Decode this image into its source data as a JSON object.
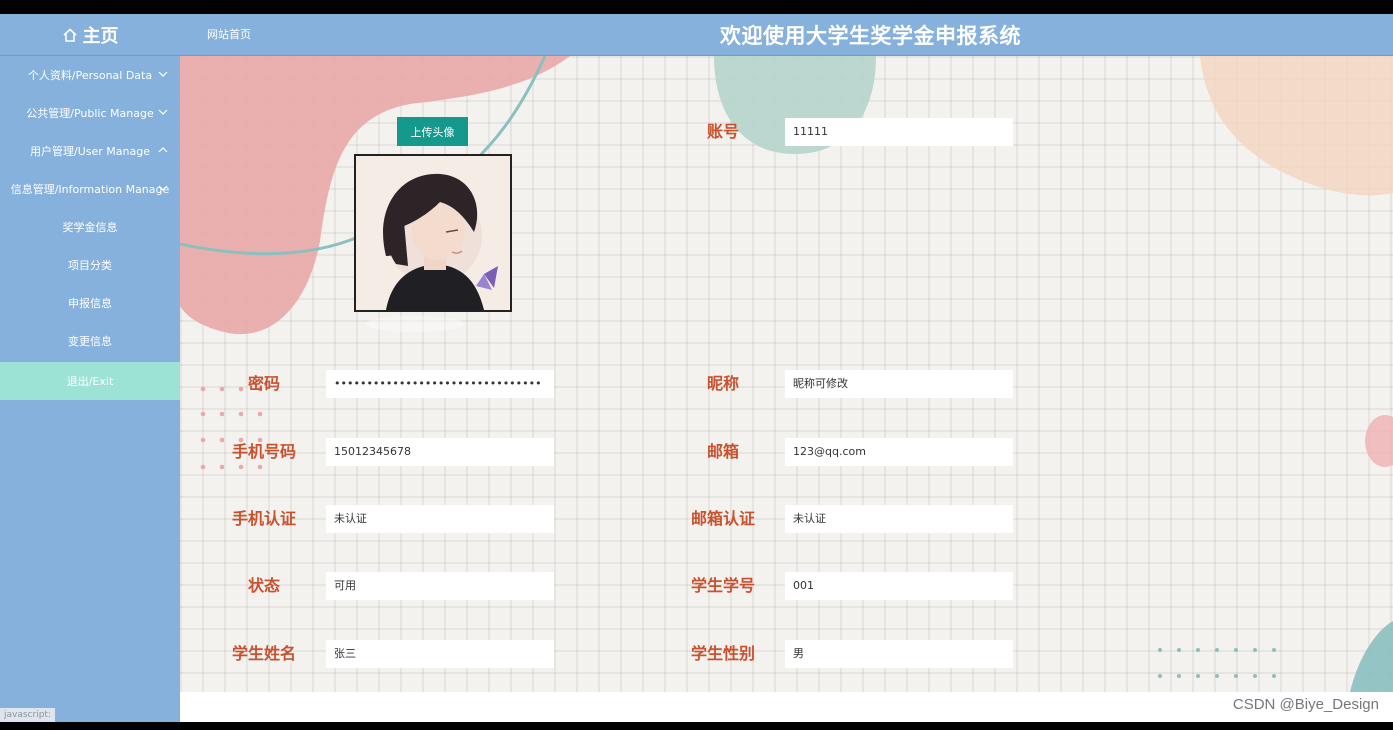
{
  "header": {
    "home_label": "主页",
    "site_link": "网站首页",
    "title": "欢迎使用大学生奖学金申报系统"
  },
  "sidebar": {
    "items": [
      {
        "label": "个人资料/Personal Data",
        "chevron": "down"
      },
      {
        "label": "公共管理/Public Manage",
        "chevron": "down"
      },
      {
        "label": "用户管理/User Manage",
        "chevron": "up"
      },
      {
        "label": "信息管理/Information Manage",
        "chevron": "down"
      },
      {
        "label": "奖学金信息"
      },
      {
        "label": "项目分类"
      },
      {
        "label": "申报信息"
      },
      {
        "label": "变更信息"
      },
      {
        "label": "退出/Exit"
      }
    ],
    "status_hint": "javascript:"
  },
  "profile": {
    "upload_label": "上传头像",
    "fields": {
      "account": {
        "label": "账号",
        "value": "11111"
      },
      "password": {
        "label": "密码",
        "value": "••••••••••••••••••••••••••••••••"
      },
      "nickname": {
        "label": "昵称",
        "value": "昵称可修改"
      },
      "phone": {
        "label": "手机号码",
        "value": "15012345678"
      },
      "email": {
        "label": "邮箱",
        "value": "123@qq.com"
      },
      "phone_verify": {
        "label": "手机认证",
        "value": "未认证"
      },
      "email_verify": {
        "label": "邮箱认证",
        "value": "未认证"
      },
      "status": {
        "label": "状态",
        "value": "可用"
      },
      "student_no": {
        "label": "学生学号",
        "value": "001"
      },
      "student_name": {
        "label": "学生姓名",
        "value": "张三"
      },
      "student_gender": {
        "label": "学生性别",
        "value": "男"
      }
    }
  },
  "colors": {
    "header_bg": "#86b1dc",
    "sidebar_bg": "#86b1dc",
    "exit_bg": "#9ce3d5",
    "label_color": "#c8522f",
    "upload_btn": "#14998c"
  },
  "watermark": "CSDN @Biye_Design"
}
